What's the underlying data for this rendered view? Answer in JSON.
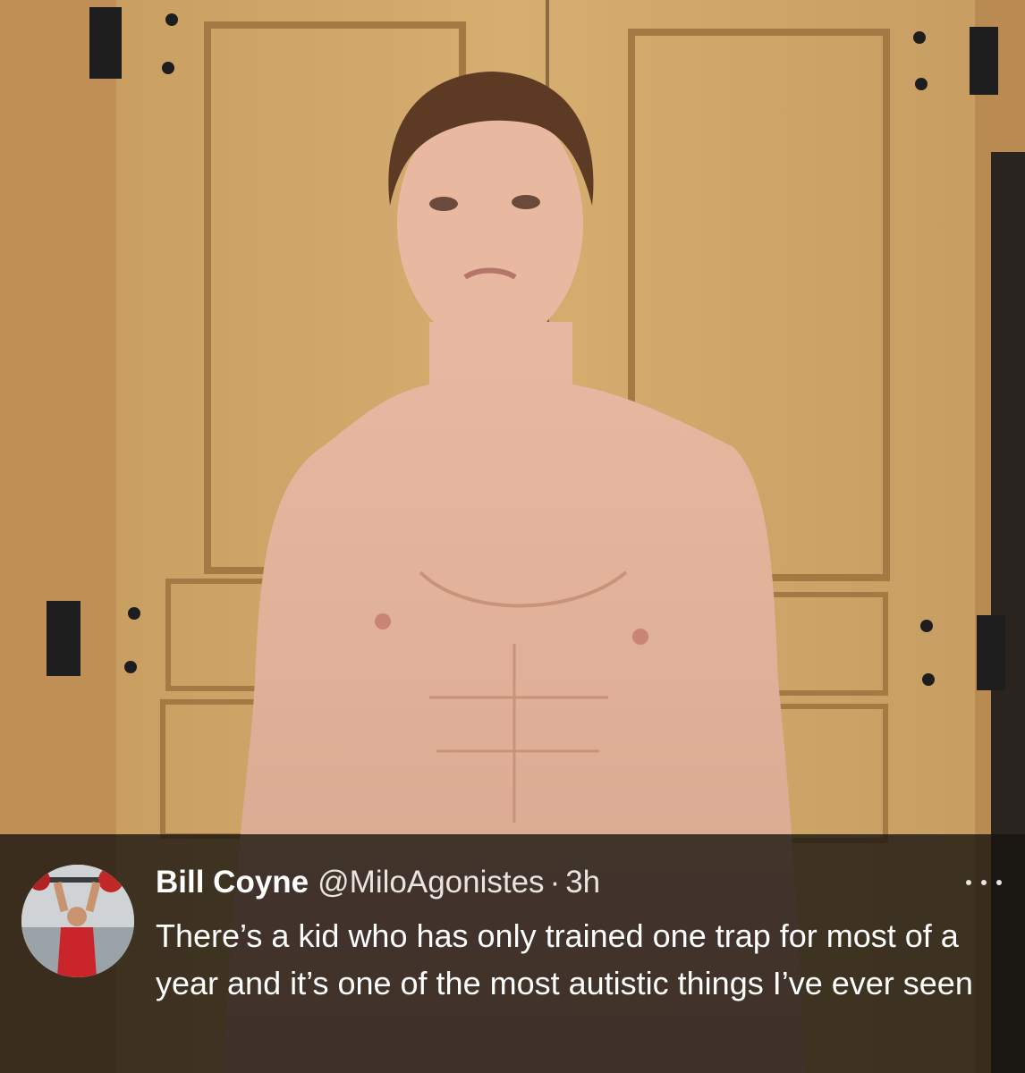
{
  "tweet": {
    "author_name": "Bill Coyne",
    "handle": "@MiloAgonistes",
    "separator": "·",
    "time": "3h",
    "text": "There’s a kid who has only trained one trap for most of a year and it’s one of the most autistic things I’ve ever seen",
    "more_icon": "more-horizontal-icon",
    "avatar_icon": "weightlifter-avatar"
  },
  "colors": {
    "overlay": "#16120e",
    "text": "#ffffff",
    "secondary_text": "#e9e4df",
    "wood": "#c9a064"
  }
}
